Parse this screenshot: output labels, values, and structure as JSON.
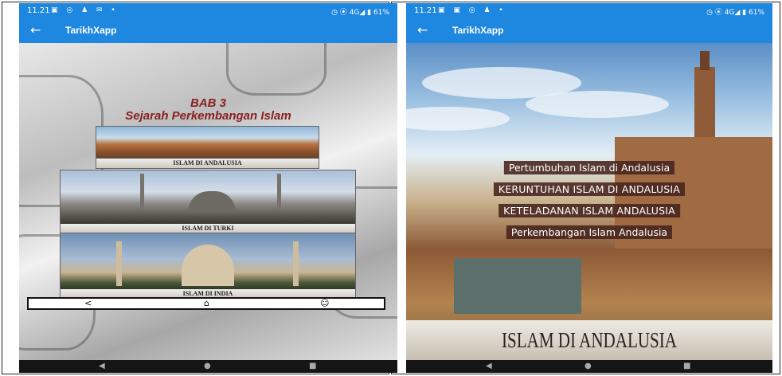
{
  "left": {
    "status": {
      "time": "11.21",
      "icons_left": "▣ ◎ ♟ ✉ •",
      "icons_right": "◷ ⦿ 4G◢ ▮ 61%"
    },
    "appbar": {
      "back": "←",
      "title": "TarikhXapp"
    },
    "bab_line1": "BAB 3",
    "bab_line2": "Sejarah Perkembangan Islam",
    "topics": [
      {
        "caption": "ISLAM DI ANDALUSIA"
      },
      {
        "caption": "ISLAM DI TURKI"
      },
      {
        "caption": "ISLAM DI INDIA"
      }
    ],
    "bottom_bar": {
      "share": "<",
      "home": "⌂",
      "profile": "☺"
    },
    "nav": {
      "back": "◀",
      "home": "●",
      "recent": "■"
    }
  },
  "right": {
    "status": {
      "time": "11.21",
      "icons_left": "▣ ▣ ◎ ♟ •",
      "icons_right": "◷ ⦿ 4G◢ ▮ 61%"
    },
    "appbar": {
      "back": "←",
      "title": "TarikhXapp"
    },
    "menu": [
      "Pertumbuhan Islam di Andalusia",
      "KERUNTUHAN ISLAM DI ANDALUSIA",
      "KETELADANAN ISLAM ANDALUSIA",
      "Perkembangan Islam Andalusia"
    ],
    "banner": "ISLAM DI ANDALUSIA",
    "nav": {
      "back": "◀",
      "home": "●",
      "recent": "■"
    }
  },
  "colors": {
    "appbar": "#1e87e0",
    "bab_text": "#8a2020",
    "menu_bg": "#46231c"
  }
}
